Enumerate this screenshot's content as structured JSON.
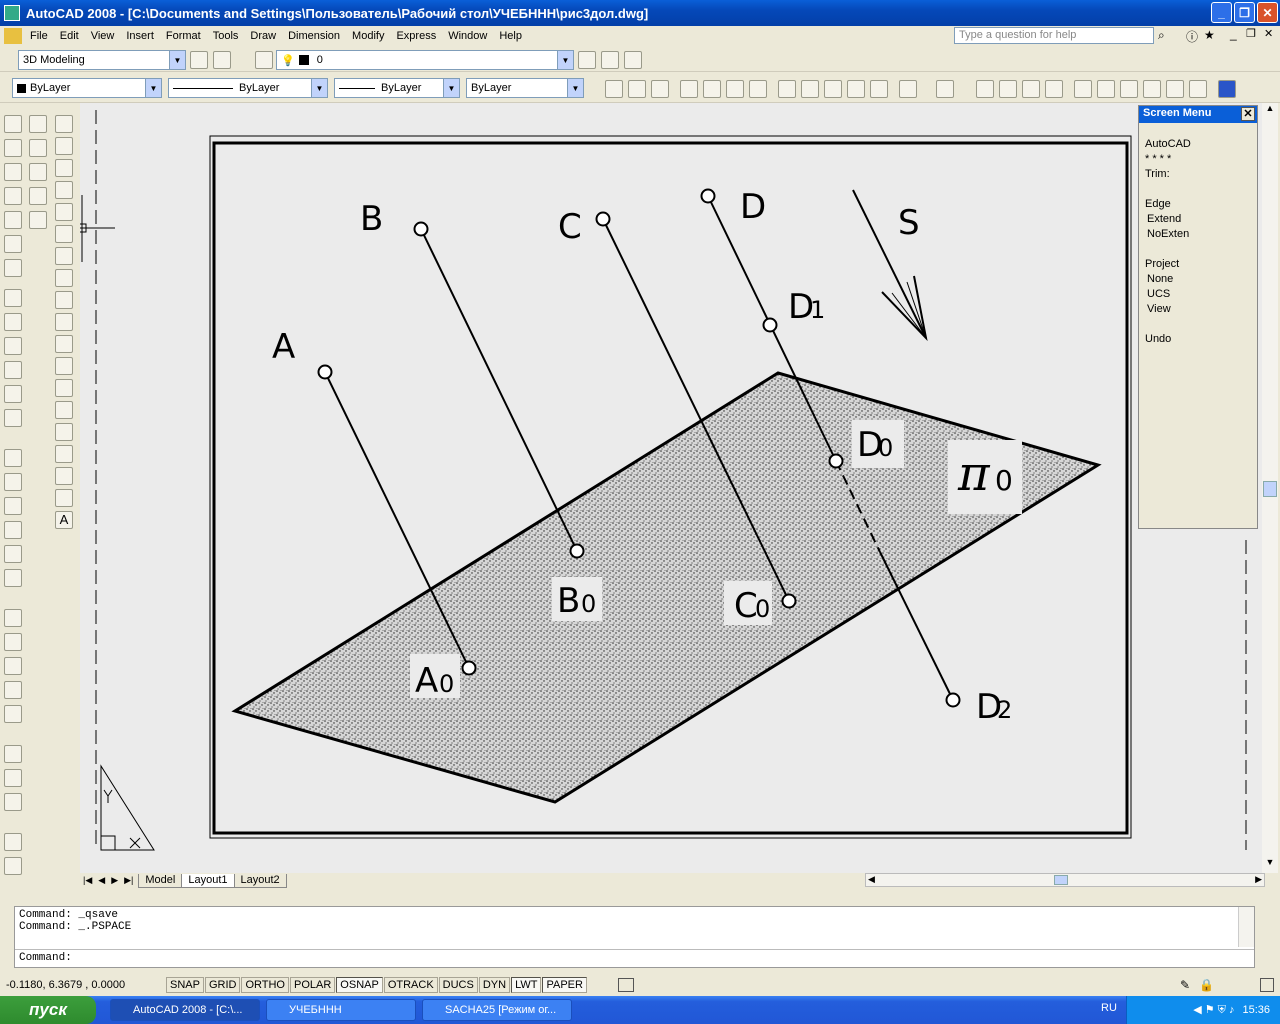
{
  "window": {
    "title": "AutoCAD 2008 - [C:\\Documents and Settings\\Пользователь\\Рабочий стол\\УЧЕБННН\\рис3дол.dwg]"
  },
  "menu": [
    "File",
    "Edit",
    "View",
    "Insert",
    "Format",
    "Tools",
    "Draw",
    "Dimension",
    "Modify",
    "Express",
    "Window",
    "Help"
  ],
  "help": {
    "placeholder": "Type a question for help"
  },
  "toolbar": {
    "workspace": "3D Modeling",
    "layer": "0",
    "color": "ByLayer",
    "linetype": "ByLayer",
    "lineweight": "ByLayer",
    "plotstyle": "ByLayer"
  },
  "drawing": {
    "labels": {
      "A": "A",
      "B": "B",
      "C": "C",
      "D": "D",
      "S": "S",
      "A0": "A",
      "A0sub": "0",
      "B0": "B",
      "B0sub": "0",
      "C0": "C",
      "C0sub": "0",
      "D0": "D",
      "D0sub": "0",
      "D1": "D",
      "D1sub": "1",
      "D2": "D",
      "D2sub": "2",
      "pi": "π",
      "pisub": "0"
    }
  },
  "tabs": [
    "Model",
    "Layout1",
    "Layout2"
  ],
  "active_tab": "Layout1",
  "screen_menu": {
    "title": "Screen Menu",
    "items": [
      "AutoCAD",
      "* * * *",
      "Trim:",
      "",
      "Edge",
      "Extend",
      "NoExten",
      "",
      "Project",
      "None",
      "UCS",
      "View",
      "",
      "Undo"
    ]
  },
  "command": {
    "lines": [
      "Command: _qsave",
      "Command: _.PSPACE"
    ],
    "prompt": "Command:"
  },
  "status": {
    "coords": "-0.1180, 6.3679 , 0.0000",
    "buttons": [
      "SNAP",
      "GRID",
      "ORTHO",
      "POLAR",
      "OSNAP",
      "OTRACK",
      "DUCS",
      "DYN",
      "LWT",
      "PAPER"
    ],
    "on": [
      "OSNAP",
      "LWT",
      "PAPER"
    ]
  },
  "taskbar": {
    "start": "пуск",
    "tasks": [
      "AutoCAD 2008 - [C:\\...",
      "УЧЕБННН",
      "SACHA25 [Режим ог..."
    ],
    "lang": "RU",
    "clock": "15:36"
  }
}
